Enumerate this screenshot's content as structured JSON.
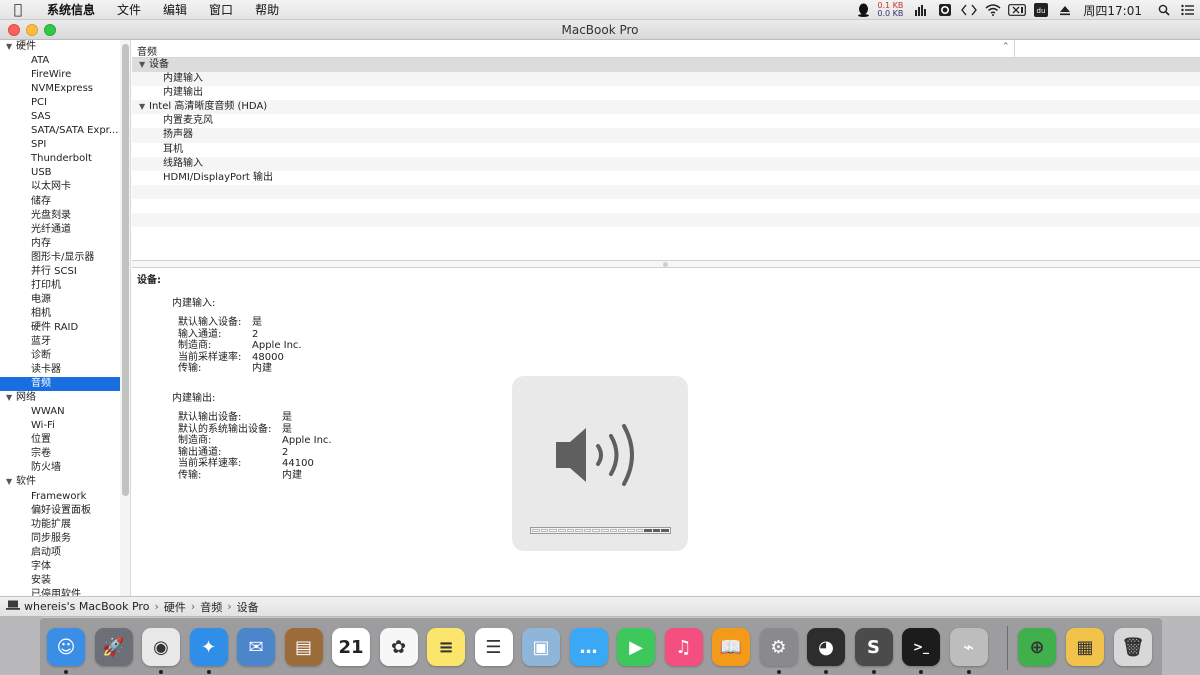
{
  "menubar": {
    "app_name": "系统信息",
    "menus": [
      "文件",
      "编辑",
      "窗口",
      "帮助"
    ],
    "net_up": "0.1 KB",
    "net_down": "0.0 KB",
    "clock": "周四17:01"
  },
  "window": {
    "title": "MacBook Pro"
  },
  "sidebar": {
    "rows": [
      {
        "label": "硬件",
        "type": "cat"
      },
      {
        "label": "ATA",
        "type": "item"
      },
      {
        "label": "FireWire",
        "type": "item"
      },
      {
        "label": "NVMExpress",
        "type": "item"
      },
      {
        "label": "PCI",
        "type": "item"
      },
      {
        "label": "SAS",
        "type": "item"
      },
      {
        "label": "SATA/SATA Expr...",
        "type": "item"
      },
      {
        "label": "SPI",
        "type": "item"
      },
      {
        "label": "Thunderbolt",
        "type": "item"
      },
      {
        "label": "USB",
        "type": "item"
      },
      {
        "label": "以太网卡",
        "type": "item"
      },
      {
        "label": "储存",
        "type": "item"
      },
      {
        "label": "光盘刻录",
        "type": "item"
      },
      {
        "label": "光纤通道",
        "type": "item"
      },
      {
        "label": "内存",
        "type": "item"
      },
      {
        "label": "图形卡/显示器",
        "type": "item"
      },
      {
        "label": "并行 SCSI",
        "type": "item"
      },
      {
        "label": "打印机",
        "type": "item"
      },
      {
        "label": "电源",
        "type": "item"
      },
      {
        "label": "相机",
        "type": "item"
      },
      {
        "label": "硬件 RAID",
        "type": "item"
      },
      {
        "label": "蓝牙",
        "type": "item"
      },
      {
        "label": "诊断",
        "type": "item"
      },
      {
        "label": "读卡器",
        "type": "item"
      },
      {
        "label": "音频",
        "type": "item",
        "selected": true
      },
      {
        "label": "网络",
        "type": "cat"
      },
      {
        "label": "WWAN",
        "type": "item"
      },
      {
        "label": "Wi-Fi",
        "type": "item"
      },
      {
        "label": "位置",
        "type": "item"
      },
      {
        "label": "宗卷",
        "type": "item"
      },
      {
        "label": "防火墙",
        "type": "item"
      },
      {
        "label": "软件",
        "type": "cat"
      },
      {
        "label": "Framework",
        "type": "item"
      },
      {
        "label": "偏好设置面板",
        "type": "item"
      },
      {
        "label": "功能扩展",
        "type": "item"
      },
      {
        "label": "同步服务",
        "type": "item"
      },
      {
        "label": "启动项",
        "type": "item"
      },
      {
        "label": "字体",
        "type": "item"
      },
      {
        "label": "安装",
        "type": "item"
      },
      {
        "label": "已停用软件",
        "type": "item"
      }
    ]
  },
  "content": {
    "column_header": "音频",
    "tree": [
      {
        "label": "设备",
        "level": 0,
        "expandable": true,
        "selected": true
      },
      {
        "label": "内建输入",
        "level": 1
      },
      {
        "label": "内建输出",
        "level": 1
      },
      {
        "label": "Intel 高清晰度音频 (HDA)",
        "level": 0,
        "expandable": true
      },
      {
        "label": "内置麦克风",
        "level": 1
      },
      {
        "label": "扬声器",
        "level": 1
      },
      {
        "label": "耳机",
        "level": 1
      },
      {
        "label": "线路输入",
        "level": 1
      },
      {
        "label": "HDMI/DisplayPort 输出",
        "level": 1
      },
      {
        "label": "",
        "level": 1
      },
      {
        "label": "",
        "level": 1
      },
      {
        "label": "",
        "level": 1
      }
    ],
    "detail": {
      "title": "设备:",
      "input": {
        "heading": "内建输入:",
        "rows": [
          {
            "key": "默认输入设备:",
            "value": "是"
          },
          {
            "key": "输入通道:",
            "value": "2"
          },
          {
            "key": "制造商:",
            "value": "Apple Inc."
          },
          {
            "key": "当前采样速率:",
            "value": "48000"
          },
          {
            "key": "传输:",
            "value": "内建"
          }
        ]
      },
      "output": {
        "heading": "内建输出:",
        "rows": [
          {
            "key": "默认输出设备:",
            "value": "是"
          },
          {
            "key": "默认的系统输出设备:",
            "value": "是"
          },
          {
            "key": "制造商:",
            "value": "Apple Inc."
          },
          {
            "key": "输出通道:",
            "value": "2"
          },
          {
            "key": "当前采样速率:",
            "value": "44100"
          },
          {
            "key": "传输:",
            "value": "内建"
          }
        ]
      }
    }
  },
  "statusbar": {
    "path": [
      "whereis's MacBook Pro",
      "硬件",
      "音频",
      "设备"
    ]
  },
  "hud": {
    "volume_segments_total": 16,
    "volume_segments_on": 3,
    "volume_fraction": 0.19
  },
  "dock": {
    "calendar_day": "21",
    "apps": [
      {
        "name": "finder-icon",
        "color": "#3a8ee6",
        "running": true
      },
      {
        "name": "launchpad-icon",
        "color": "#6d6f76",
        "running": false
      },
      {
        "name": "chrome-icon",
        "color": "#e8e8e8",
        "running": true
      },
      {
        "name": "safari-icon",
        "color": "#2f8fe8",
        "running": true
      },
      {
        "name": "mail-icon",
        "color": "#4a86c9",
        "running": false
      },
      {
        "name": "contacts-icon",
        "color": "#9b6b3a",
        "running": false
      },
      {
        "name": "calendar-icon",
        "color": "#ffffff",
        "running": false
      },
      {
        "name": "photos-icon",
        "color": "#f7f7f7",
        "running": false
      },
      {
        "name": "notes-icon",
        "color": "#fbe66b",
        "running": false
      },
      {
        "name": "reminders-icon",
        "color": "#ffffff",
        "running": false
      },
      {
        "name": "preview-icon",
        "color": "#8fb6d9",
        "running": false
      },
      {
        "name": "messages-icon",
        "color": "#3aa8f5",
        "running": false
      },
      {
        "name": "facetime-icon",
        "color": "#3cc85b",
        "running": false
      },
      {
        "name": "itunes-icon",
        "color": "#f54f80",
        "running": false
      },
      {
        "name": "ibooks-icon",
        "color": "#f39a1b",
        "running": false
      },
      {
        "name": "system-preferences-icon",
        "color": "#8a8a8e",
        "running": true
      },
      {
        "name": "qq-icon",
        "color": "#2d2d2d",
        "running": true
      },
      {
        "name": "sublime-text-icon",
        "color": "#4b4b4b",
        "running": true
      },
      {
        "name": "terminal-icon",
        "color": "#1c1c1c",
        "running": true
      },
      {
        "name": "system-information-icon",
        "color": "#bdbdbd",
        "running": true
      }
    ],
    "extras": [
      {
        "name": "download-folder-icon",
        "color": "#3fb04b"
      },
      {
        "name": "documents-stack-icon",
        "color": "#f2c34b"
      },
      {
        "name": "trash-icon",
        "color": "#d8d8d8"
      }
    ]
  }
}
